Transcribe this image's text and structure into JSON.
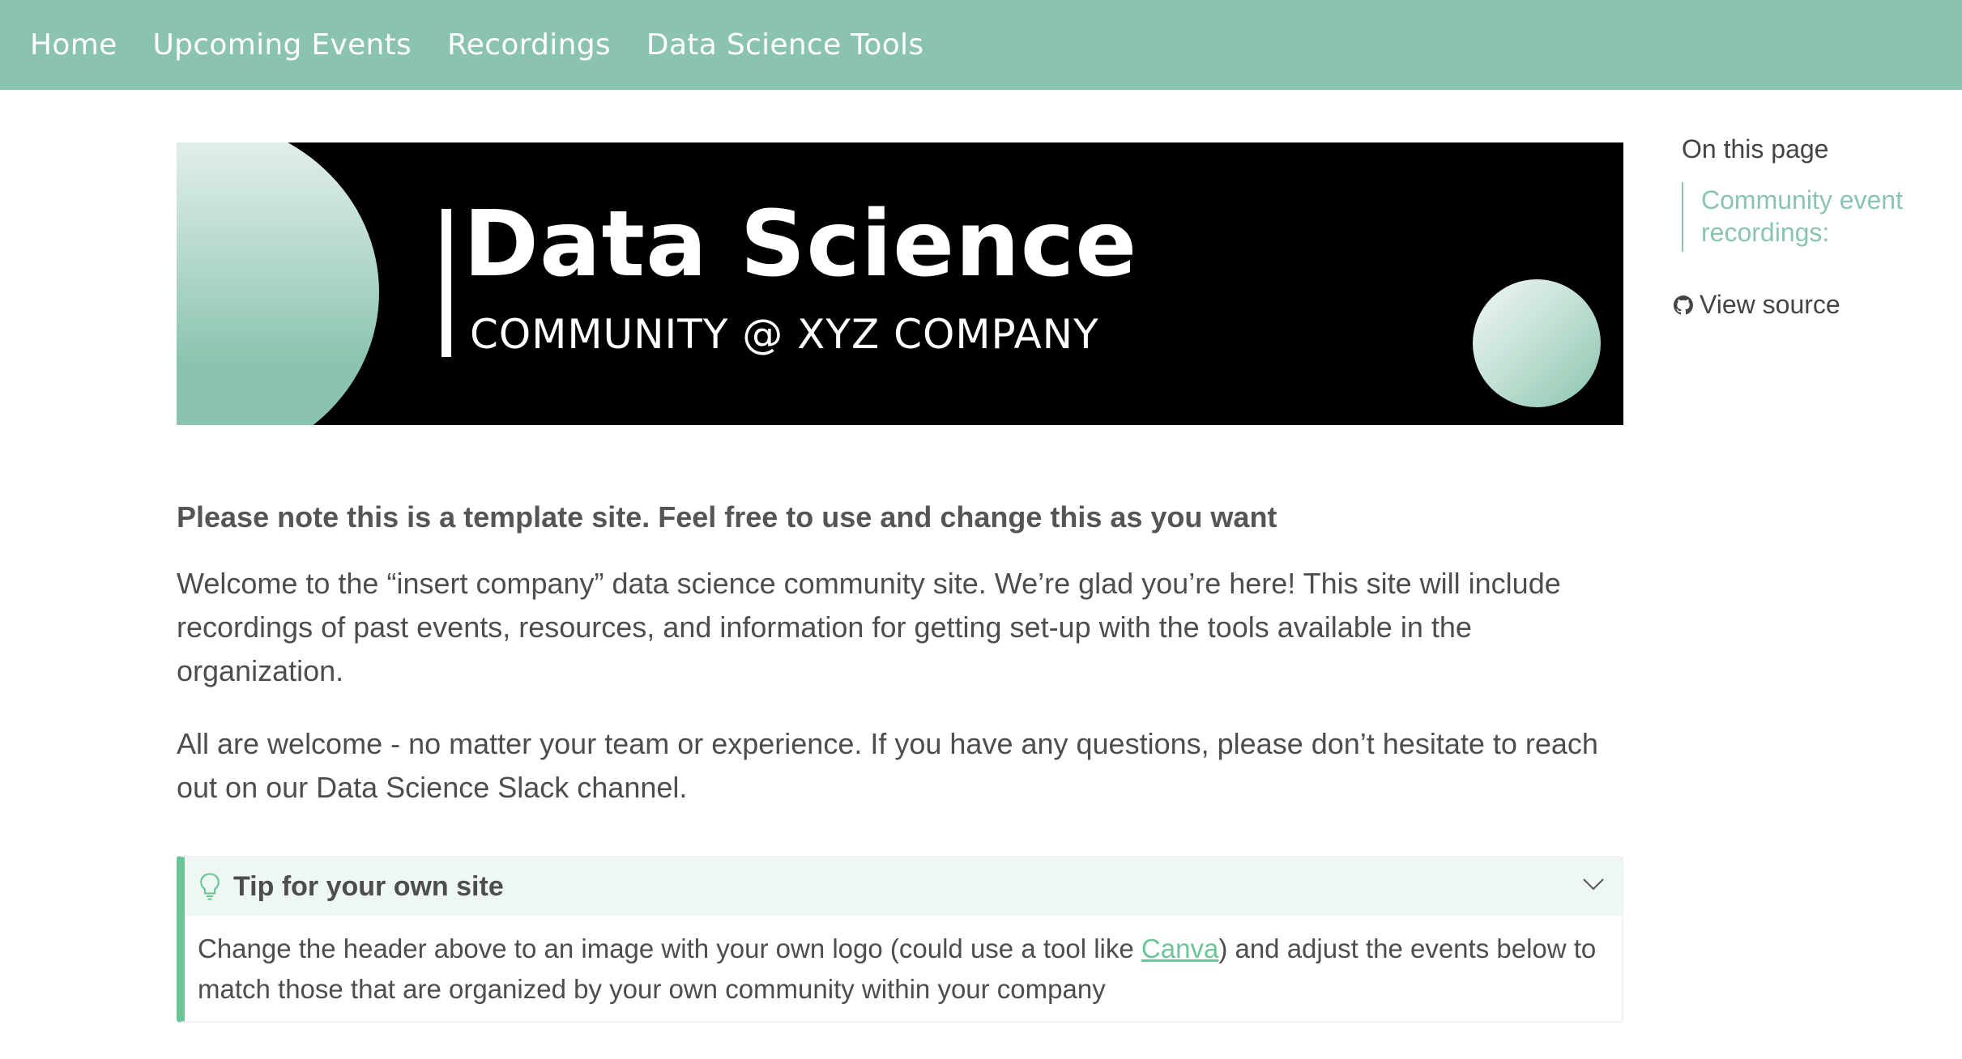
{
  "nav": {
    "items": [
      {
        "label": "Home"
      },
      {
        "label": "Upcoming Events"
      },
      {
        "label": "Recordings"
      },
      {
        "label": "Data Science Tools"
      }
    ]
  },
  "banner": {
    "title": "Data Science",
    "subtitle": "COMMUNITY @ XYZ COMPANY"
  },
  "main": {
    "note": "Please note this is a template site. Feel free to use and change this as you want",
    "welcome": "Welcome to the “insert company” data science community site. We’re glad you’re here! This site will include recordings of past events, resources, and information for getting set-up with the tools available in the organization.",
    "all_welcome": "All are welcome - no matter your team or experience. If you have any questions, please don’t hesitate to reach out on our Data Science Slack channel."
  },
  "tip": {
    "title": "Tip for your own site",
    "body_before": "Change the header above to an image with your own logo (could use a tool like ",
    "link": "Canva",
    "body_after": ") and adjust the events below to match those that are organized by your own community within your company",
    "icon": "lightbulb-icon"
  },
  "toc": {
    "heading": "On this page",
    "links": [
      {
        "label": "Community event recordings:"
      }
    ]
  },
  "view_source": {
    "label": "View source",
    "icon": "github-icon"
  },
  "colors": {
    "accent": "#8ac4ae",
    "admonition_border": "#6cc596",
    "admonition_bg": "#eef7f2"
  }
}
